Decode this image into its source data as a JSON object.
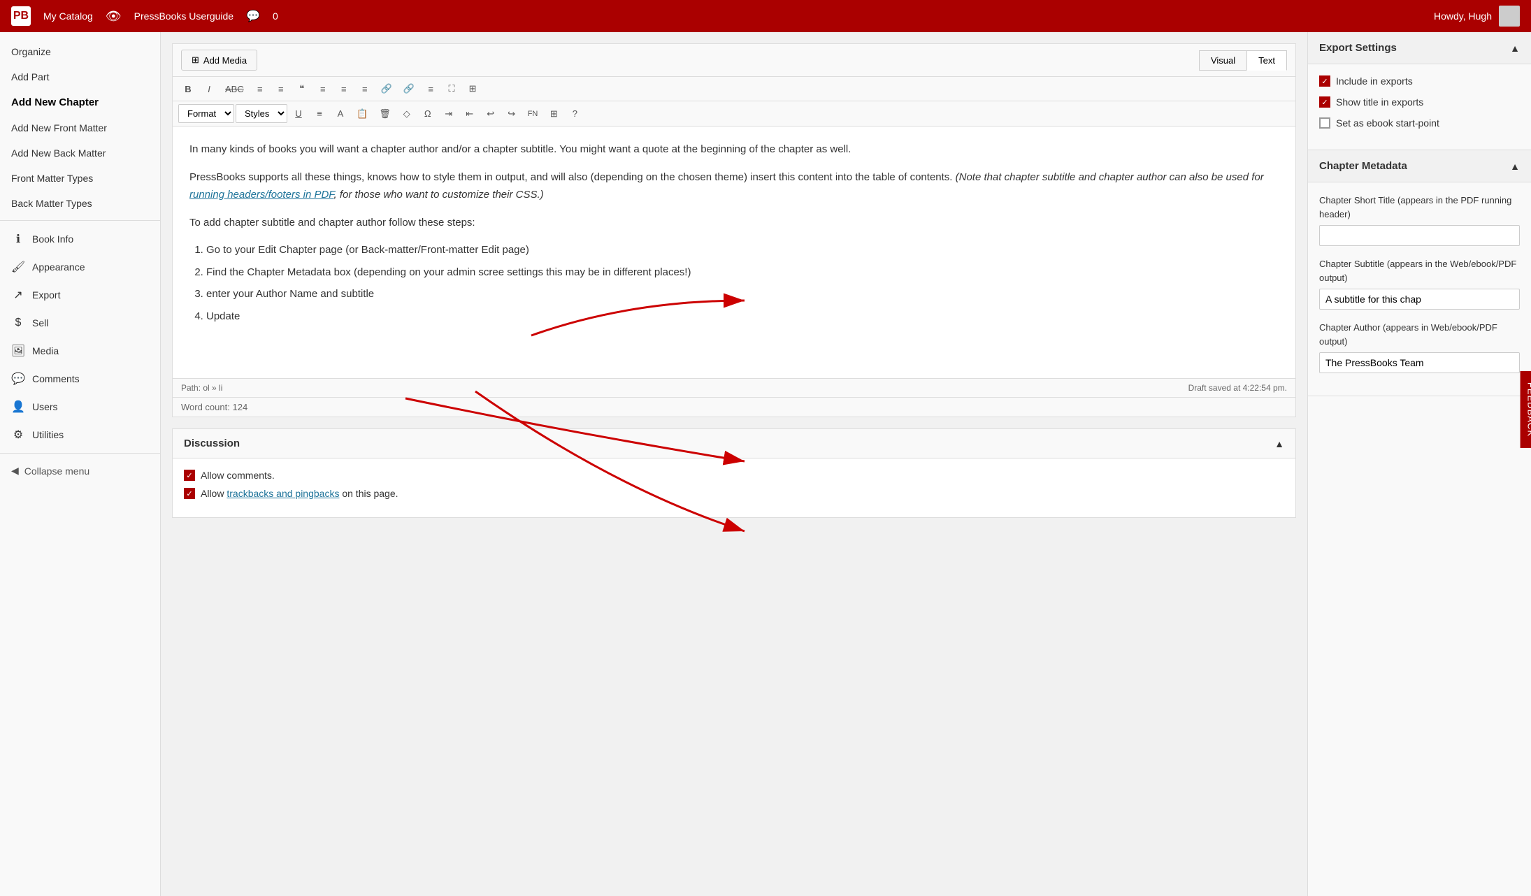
{
  "topnav": {
    "logo": "PB",
    "catalog_label": "My Catalog",
    "book_label": "PressBooks Userguide",
    "comments_count": "0",
    "howdy": "Howdy, Hugh"
  },
  "sidebar": {
    "items": [
      {
        "id": "organize",
        "label": "Organize",
        "icon": "",
        "active": false
      },
      {
        "id": "add-part",
        "label": "Add Part",
        "icon": "",
        "active": false
      },
      {
        "id": "add-new-chapter",
        "label": "Add New Chapter",
        "icon": "",
        "active": true,
        "bold": true
      },
      {
        "id": "add-new-front-matter",
        "label": "Add New Front Matter",
        "icon": "",
        "active": false
      },
      {
        "id": "add-new-back-matter",
        "label": "Add New Back Matter",
        "icon": "",
        "active": false
      },
      {
        "id": "front-matter-types",
        "label": "Front Matter Types",
        "icon": "",
        "active": false
      },
      {
        "id": "back-matter-types",
        "label": "Back Matter Types",
        "icon": "",
        "active": false
      }
    ],
    "icon_items": [
      {
        "id": "book-info",
        "label": "Book Info",
        "icon": "ℹ"
      },
      {
        "id": "appearance",
        "label": "Appearance",
        "icon": "🖌"
      },
      {
        "id": "export",
        "label": "Export",
        "icon": "↗"
      },
      {
        "id": "sell",
        "label": "Sell",
        "icon": "$"
      },
      {
        "id": "media",
        "label": "Media",
        "icon": "🖼"
      },
      {
        "id": "comments",
        "label": "Comments",
        "icon": "💬"
      },
      {
        "id": "users",
        "label": "Users",
        "icon": "👤"
      },
      {
        "id": "utilities",
        "label": "Utilities",
        "icon": "⚙"
      },
      {
        "id": "collapse-menu",
        "label": "Collapse menu",
        "icon": "←"
      }
    ]
  },
  "editor": {
    "add_media_label": "Add Media",
    "tab_visual": "Visual",
    "tab_text": "Text",
    "toolbar_row1": [
      "B",
      "I",
      "ABC",
      "≡",
      "≡",
      "❝",
      "≡",
      "≡",
      "≡",
      "🔗",
      "🔗",
      "≡",
      "⊞",
      "⊞"
    ],
    "toolbar_row2_format": "Format",
    "toolbar_row2_styles": "Styles",
    "content_paragraphs": [
      "In many kinds of books you will want a chapter author and/or a chapter subtitle. You might want a quote at the beginning of the chapter as well.",
      "PressBooks supports all these things, knows how to style them in output, and will also (depending on the chosen theme) insert this content into the table of contents.",
      "To add chapter subtitle and chapter author follow these steps:"
    ],
    "italic_text": "(Note that chapter subtitle and chapter author can also be used for running headers/footers in PDF, for those who want to customize their CSS.)",
    "link_text": "running headers/footers in PDF",
    "list_items": [
      "Go to your Edit Chapter page (or Back-matter/Front-matter Edit page)",
      "Find the Chapter Metadata box (depending on your admin scree settings this may be in different places!)",
      "enter your Author Name and subtitle",
      "Update"
    ],
    "path": "Path: ol » li",
    "word_count_label": "Word count:",
    "word_count": "124",
    "draft_saved": "Draft saved at 4:22:54 pm."
  },
  "discussion": {
    "title": "Discussion",
    "allow_comments": "Allow comments.",
    "allow_trackbacks": "Allow",
    "trackbacks_link": "trackbacks and pingbacks",
    "trackbacks_suffix": "on this page."
  },
  "export_settings": {
    "title": "Export Settings",
    "include_exports_label": "Include in exports",
    "show_title_label": "Show title in exports",
    "set_ebook_label": "Set as ebook start-point",
    "include_checked": true,
    "show_title_checked": true,
    "set_ebook_checked": false
  },
  "chapter_metadata": {
    "title": "Chapter Metadata",
    "short_title_label": "Chapter Short Title (appears in the PDF running header)",
    "short_title_value": "",
    "subtitle_label": "Chapter Subtitle (appears in the Web/ebook/PDF output)",
    "subtitle_value": "A subtitle for this chap",
    "author_label": "Chapter Author (appears in Web/ebook/PDF output)",
    "author_value": "The PressBooks Team"
  },
  "feedback": {
    "label": "FEEDBACK"
  }
}
